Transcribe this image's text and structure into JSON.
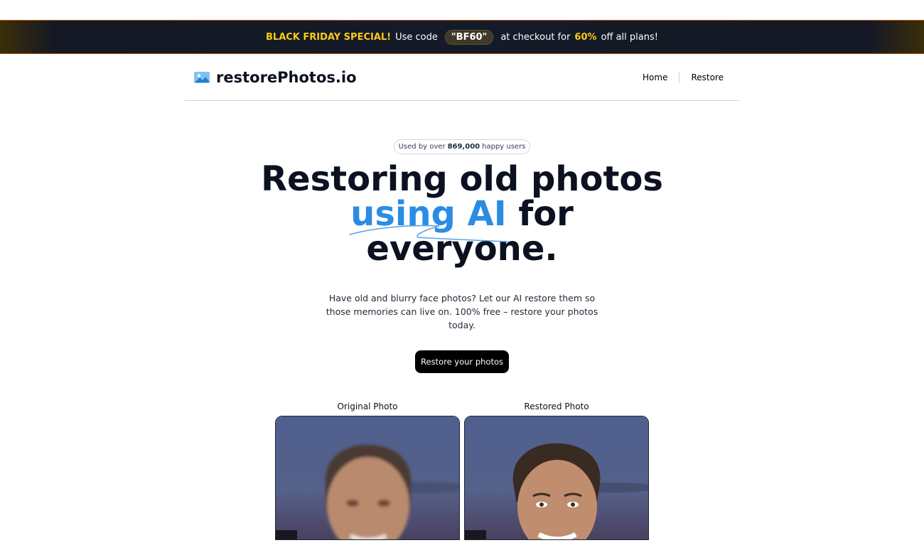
{
  "banner": {
    "special": "BLACK FRIDAY SPECIAL!",
    "use_code": "Use code",
    "code": "\"BF60\"",
    "at_checkout": "at checkout for",
    "percent": "60%",
    "rest": "off all plans!"
  },
  "header": {
    "logo_text": "restorePhotos.io",
    "nav": [
      {
        "label": "Home"
      },
      {
        "label": "Restore"
      }
    ]
  },
  "hero": {
    "pill_prefix": "Used by over",
    "pill_count": "869,000",
    "pill_suffix": "happy users",
    "title_line1": "Restoring old photos",
    "title_blue": "using AI",
    "title_for": "for",
    "title_line3": "everyone.",
    "subtext": "Have old and blurry face photos? Let our AI restore them so those memories can live on. 100% free – restore your photos today.",
    "cta_label": "Restore your photos"
  },
  "comparison": {
    "original_label": "Original Photo",
    "restored_label": "Restored Photo"
  },
  "colors": {
    "accent_blue": "#2b8ce4",
    "highlight_yellow": "#facc15",
    "banner_bg": "#141a28"
  },
  "icons": [
    "photo-logo-icon"
  ]
}
